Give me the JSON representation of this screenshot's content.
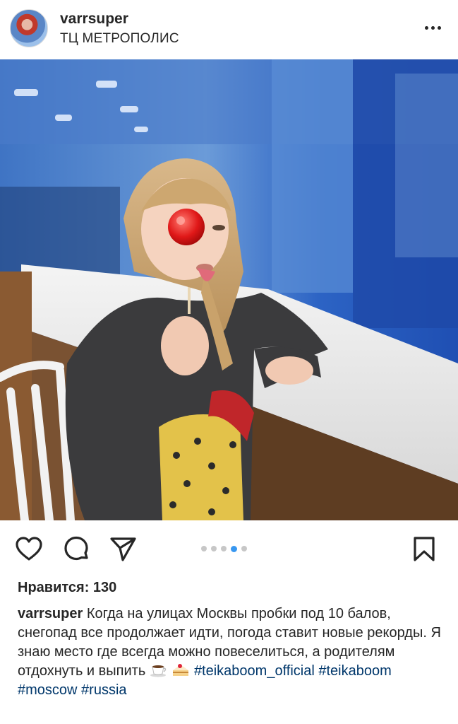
{
  "header": {
    "username": "varrsuper",
    "location": "ТЦ МЕТРОПОЛИС",
    "avatar_icon": "profile-avatar",
    "more_icon": "more-horizontal-icon"
  },
  "photo": {
    "description_icon": "post-photo"
  },
  "actions": {
    "like_icon": "heart-icon",
    "comment_icon": "comment-icon",
    "share_icon": "send-icon",
    "save_icon": "bookmark-icon",
    "carousel": {
      "count": 5,
      "active_index": 3,
      "active_color": "#3897f0"
    }
  },
  "likes": {
    "text": "Нравится: 130"
  },
  "caption": {
    "username": "varrsuper",
    "text": "Когда на улицах Москвы пробки под 10 балов, снегопад все продолжает идти, погода ставит новые рекорды. Я знаю место где всегда можно повеселиться, а родителям отдохнуть и выпить",
    "emojis": [
      "coffee-cup-icon",
      "cake-icon"
    ],
    "hashtags": [
      "#teikaboom_official",
      "#teikaboom",
      "#moscow",
      "#russia"
    ],
    "hashtag_color": "#00376b"
  }
}
